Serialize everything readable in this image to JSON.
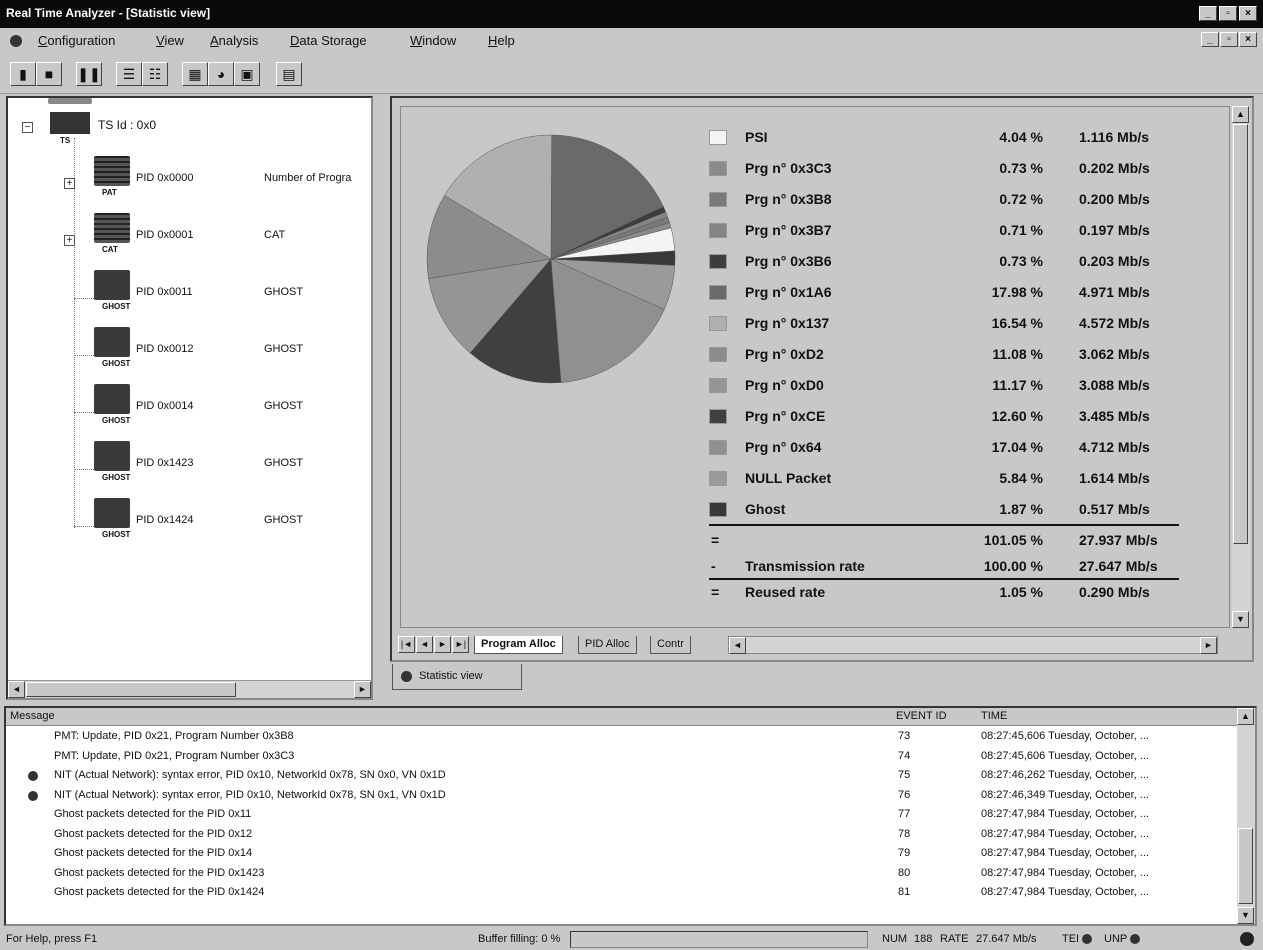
{
  "window": {
    "title": "Real Time Analyzer - [Statistic view]"
  },
  "menu": [
    "Configuration",
    "View",
    "Analysis",
    "Data Storage",
    "Window",
    "Help"
  ],
  "tree": {
    "root": {
      "label": "TS Id : 0x0",
      "tag": "TS"
    },
    "nodes": [
      {
        "label": "PID 0x0000",
        "desc": "Number of Progra",
        "tag": "PAT",
        "expandable": true,
        "icon": "grid-table-icon"
      },
      {
        "label": "PID 0x0001",
        "desc": "CAT",
        "tag": "CAT",
        "expandable": true,
        "icon": "grid-table-icon"
      },
      {
        "label": "PID 0x0011",
        "desc": "GHOST",
        "tag": "GHOST",
        "expandable": false,
        "icon": "ghost-icon"
      },
      {
        "label": "PID 0x0012",
        "desc": "GHOST",
        "tag": "GHOST",
        "expandable": false,
        "icon": "ghost-icon"
      },
      {
        "label": "PID 0x0014",
        "desc": "GHOST",
        "tag": "GHOST",
        "expandable": false,
        "icon": "ghost-icon"
      },
      {
        "label": "PID 0x1423",
        "desc": "GHOST",
        "tag": "GHOST",
        "expandable": false,
        "icon": "ghost-icon"
      },
      {
        "label": "PID 0x1424",
        "desc": "GHOST",
        "tag": "GHOST",
        "expandable": false,
        "icon": "ghost-icon"
      }
    ]
  },
  "chart_data": {
    "type": "pie",
    "slices": [
      {
        "name": "PSI",
        "percent": 4.04,
        "rate": "1.116 Mb/s",
        "pct_label": "4.04 %",
        "color": "#f4f4f4"
      },
      {
        "name": "Prg n° 0x3C3",
        "percent": 0.73,
        "rate": "0.202 Mb/s",
        "pct_label": "0.73 %",
        "color": "#8a8a8a"
      },
      {
        "name": "Prg n° 0x3B8",
        "percent": 0.72,
        "rate": "0.200 Mb/s",
        "pct_label": "0.72 %",
        "color": "#7a7a7a"
      },
      {
        "name": "Prg n° 0x3B7",
        "percent": 0.71,
        "rate": "0.197 Mb/s",
        "pct_label": "0.71 %",
        "color": "#858585"
      },
      {
        "name": "Prg n° 0x3B6",
        "percent": 0.73,
        "rate": "0.203 Mb/s",
        "pct_label": "0.73 %",
        "color": "#3c3c3c"
      },
      {
        "name": "Prg n° 0x1A6",
        "percent": 17.98,
        "rate": "4.971 Mb/s",
        "pct_label": "17.98 %",
        "color": "#6a6a6a"
      },
      {
        "name": "Prg n° 0x137",
        "percent": 16.54,
        "rate": "4.572 Mb/s",
        "pct_label": "16.54 %",
        "color": "#b0b0b0"
      },
      {
        "name": "Prg n° 0xD2",
        "percent": 11.08,
        "rate": "3.062 Mb/s",
        "pct_label": "11.08 %",
        "color": "#8c8c8c"
      },
      {
        "name": "Prg n° 0xD0",
        "percent": 11.17,
        "rate": "3.088 Mb/s",
        "pct_label": "11.17 %",
        "color": "#959595"
      },
      {
        "name": "Prg n° 0xCE",
        "percent": 12.6,
        "rate": "3.485 Mb/s",
        "pct_label": "12.60 %",
        "color": "#404040"
      },
      {
        "name": "Prg n° 0x64",
        "percent": 17.04,
        "rate": "4.712 Mb/s",
        "pct_label": "17.04 %",
        "color": "#909090"
      },
      {
        "name": "NULL Packet",
        "percent": 5.84,
        "rate": "1.614 Mb/s",
        "pct_label": "5.84 %",
        "color": "#9a9a9a"
      },
      {
        "name": "Ghost",
        "percent": 1.87,
        "rate": "0.517 Mb/s",
        "pct_label": "1.87 %",
        "color": "#383838"
      }
    ],
    "totals": [
      {
        "sym": "=",
        "name": "",
        "pct": "101.05 %",
        "rate": "27.937 Mb/s"
      },
      {
        "sym": "-",
        "name": "Transmission rate",
        "pct": "100.00 %",
        "rate": "27.647 Mb/s"
      },
      {
        "sym": "=",
        "name": "Reused rate",
        "pct": "1.05 %",
        "rate": "0.290 Mb/s"
      }
    ],
    "clipped_row": {
      "name": "Transmission rate",
      "pct": "100.00 %",
      "rate": "27.647 Mb/s"
    }
  },
  "tabs": [
    "Program Alloc",
    "PID Alloc",
    "Contr"
  ],
  "view_tab": "Statistic view",
  "messages": {
    "headers": {
      "message": "Message",
      "event": "EVENT ID",
      "time": "TIME"
    },
    "rows": [
      {
        "icon": false,
        "text": "PMT: Update, PID 0x21, Program Number 0x3B8",
        "event": "73",
        "time": "08:27:45,606 Tuesday, October, ..."
      },
      {
        "icon": false,
        "text": "PMT: Update, PID 0x21, Program Number 0x3C3",
        "event": "74",
        "time": "08:27:45,606 Tuesday, October, ..."
      },
      {
        "icon": true,
        "text": "NIT (Actual Network): syntax error, PID 0x10, NetworkId 0x78, SN 0x0, VN 0x1D",
        "event": "75",
        "time": "08:27:46,262 Tuesday, October, ..."
      },
      {
        "icon": true,
        "text": "NIT (Actual Network): syntax error, PID 0x10, NetworkId 0x78, SN 0x1, VN 0x1D",
        "event": "76",
        "time": "08:27:46,349 Tuesday, October, ..."
      },
      {
        "icon": false,
        "text": "Ghost packets detected for the PID 0x11",
        "event": "77",
        "time": "08:27:47,984 Tuesday, October, ..."
      },
      {
        "icon": false,
        "text": "Ghost packets detected for the PID 0x12",
        "event": "78",
        "time": "08:27:47,984 Tuesday, October, ..."
      },
      {
        "icon": false,
        "text": "Ghost packets detected for the PID 0x14",
        "event": "79",
        "time": "08:27:47,984 Tuesday, October, ..."
      },
      {
        "icon": false,
        "text": "Ghost packets detected for the PID 0x1423",
        "event": "80",
        "time": "08:27:47,984 Tuesday, October, ..."
      },
      {
        "icon": false,
        "text": "Ghost packets detected for the PID 0x1424",
        "event": "81",
        "time": "08:27:47,984 Tuesday, October, ..."
      }
    ]
  },
  "status": {
    "help": "For Help, press F1",
    "buffer": "Buffer filling: 0 %",
    "num": "NUM",
    "num_value": "188",
    "rate_label": "RATE",
    "rate_value": "27.647 Mb/s",
    "tei": "TEI",
    "unp": "UNP"
  }
}
